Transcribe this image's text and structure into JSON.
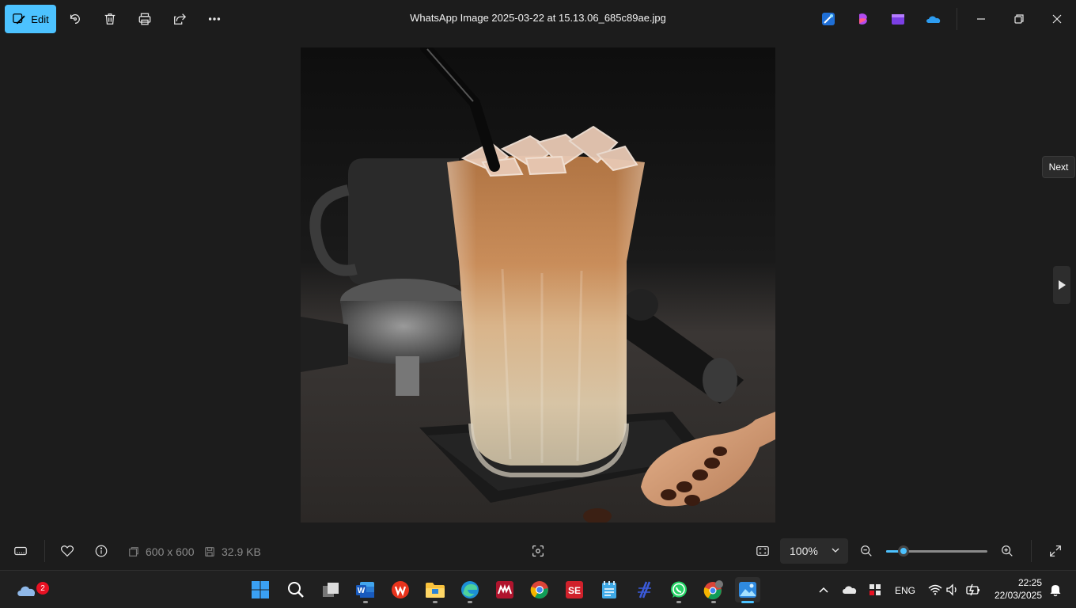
{
  "topbar": {
    "edit_label": "Edit",
    "title": "WhatsApp Image 2025-03-22 at 15.13.06_685c89ae.jpg",
    "icons": [
      "rotate-icon",
      "delete-icon",
      "print-icon",
      "share-icon",
      "more-icon"
    ],
    "app_icons": [
      "designer-icon",
      "clipchamp-like-icon",
      "clipchamp-icon",
      "onedrive-icon"
    ]
  },
  "viewer": {
    "next_tooltip": "Next"
  },
  "bottombar": {
    "dimensions": "600 x 600",
    "file_size": "32.9 KB",
    "zoom_value": "100%",
    "zoom_level": 0.17
  },
  "taskbar": {
    "weather_badge": "2",
    "language": "ENG",
    "time": "22:25",
    "date": "22/03/2025"
  },
  "colors": {
    "accent": "#4cc2ff",
    "background": "#1c1c1c",
    "taskbar": "#202020"
  }
}
